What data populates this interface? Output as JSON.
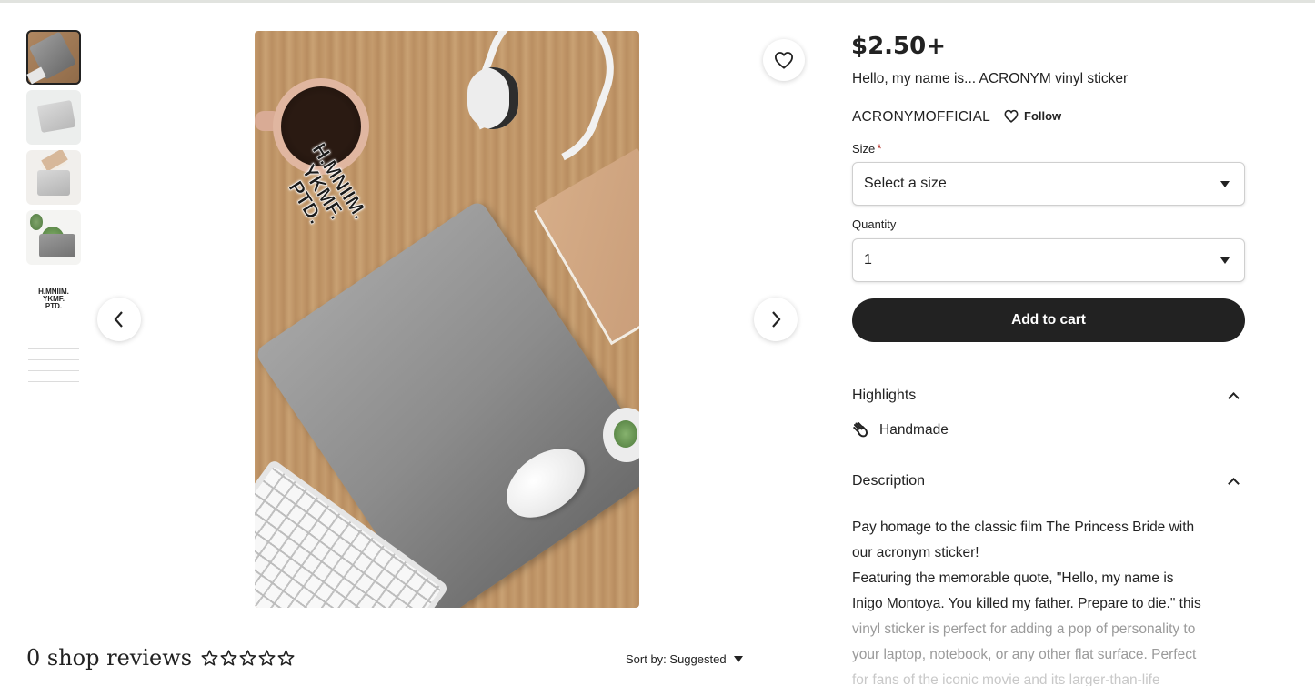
{
  "product": {
    "price": "$2.50+",
    "title": "Hello, my name is... ACRONYM vinyl sticker",
    "shop_name": "ACRONYMOFFICIAL",
    "follow_label": "Follow"
  },
  "gallery": {
    "sticker_lines": [
      "H.MNIIM.",
      "YKMF.",
      "PTD."
    ],
    "thumb_sticker_lines": [
      "H.MNIIM.",
      "YKMF.",
      "PTD."
    ],
    "icons": {
      "favorite": "heart-icon",
      "prev": "chevron-left-icon",
      "next": "chevron-right-icon"
    }
  },
  "options": {
    "size_label": "Size",
    "size_required_mark": "*",
    "size_value": "Select a size",
    "quantity_label": "Quantity",
    "quantity_value": "1"
  },
  "cart": {
    "label": "Add to cart"
  },
  "highlights": {
    "heading": "Highlights",
    "item": "Handmade"
  },
  "description": {
    "heading": "Description",
    "line1": "Pay homage to the classic film The Princess Bride with",
    "line2": "our acronym sticker!",
    "line3": "Featuring the memorable quote, \"Hello, my name is",
    "line4": "Inigo Montoya. You killed my father. Prepare to die.\" this",
    "line5": "vinyl sticker is perfect for adding a pop of personality to",
    "line6": "your laptop, notebook, or any other flat surface. Perfect",
    "line7": "for fans of the iconic movie and its larger-than-life"
  },
  "reviews": {
    "title": "0 shop reviews",
    "rating": 0,
    "max_rating": 5,
    "sort_label": "Sort by: Suggested"
  },
  "colors": {
    "text": "#222222",
    "cart_button": "#222222",
    "required": "#b3261e"
  }
}
